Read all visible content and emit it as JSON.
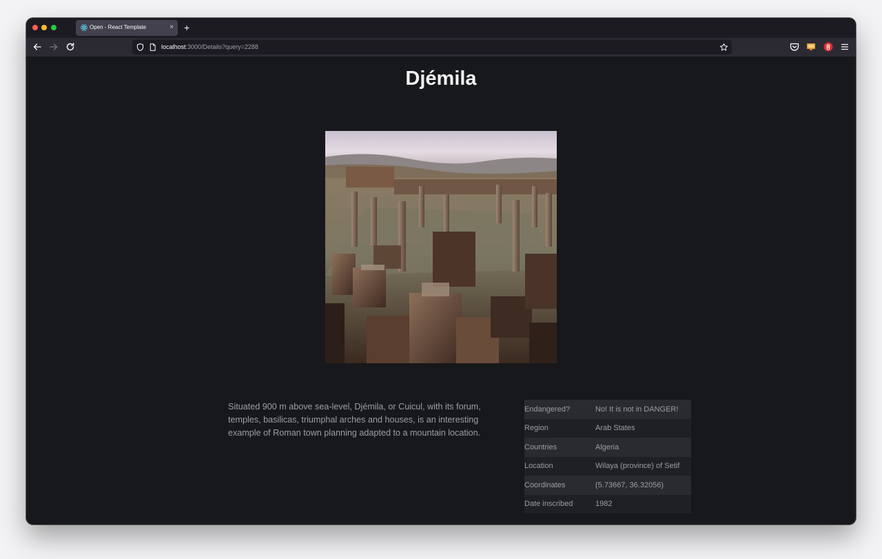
{
  "browser": {
    "tab_title": "Open - React Template",
    "tab_close": "×",
    "new_tab": "+",
    "url_host": "localhost",
    "url_rest": ":3000/Details?query=2288"
  },
  "site": {
    "name": "Djémila",
    "description": "Situated 900 m above sea-level, Djémila, or Cuicul, with its forum, temples, basilicas, triumphal arches and houses, is an interesting example of Roman town planning adapted to a mountain location.",
    "info": [
      {
        "label": "Endangered?",
        "value": "No! It is not in DANGER!"
      },
      {
        "label": "Region",
        "value": "Arab States"
      },
      {
        "label": "Countries",
        "value": "Algeria"
      },
      {
        "label": "Location",
        "value": "Wilaya (province) of Setif"
      },
      {
        "label": "Coordinates",
        "value": "(5.73667, 36.32056)"
      },
      {
        "label": "Date inscribed",
        "value": "1982"
      }
    ]
  },
  "colors": {
    "page_background": "#17181b",
    "title_text": "#f2f2f4",
    "body_text": "#9a9ea6",
    "table_row_odd": "#2a2b2f",
    "table_row_even": "#1f2023"
  }
}
